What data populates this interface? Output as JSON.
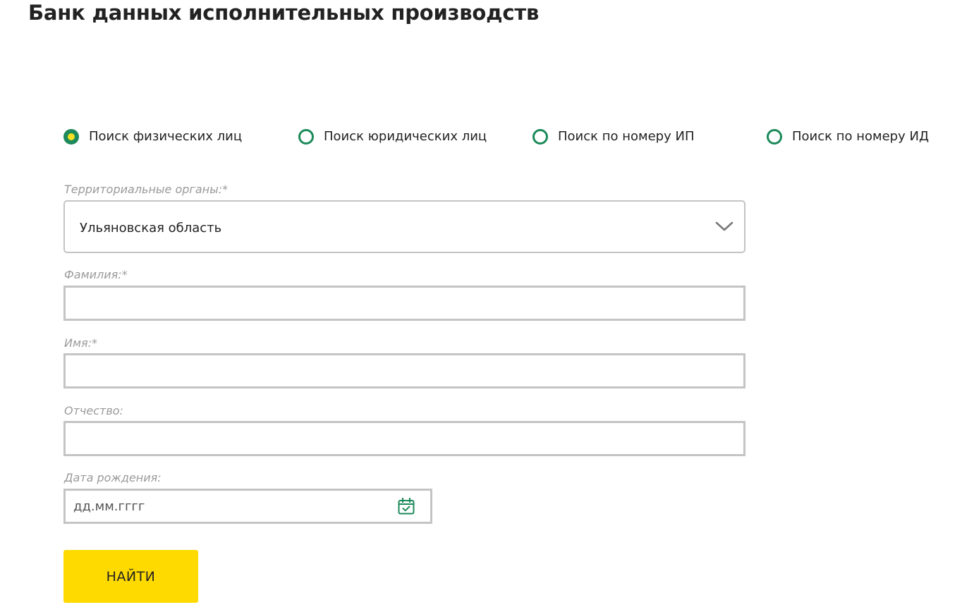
{
  "page": {
    "title": "Банк данных исполнительных производств"
  },
  "search_type": {
    "options": [
      {
        "label": "Поиск физических лиц",
        "checked": true
      },
      {
        "label": "Поиск юридических лиц",
        "checked": false
      },
      {
        "label": "Поиск по номеру ИП",
        "checked": false
      },
      {
        "label": "Поиск по номеру ИД",
        "checked": false
      }
    ]
  },
  "form": {
    "territorial_label": "Территориальные органы:*",
    "territorial_value": "Ульяновская область",
    "lastname_label": "Фамилия:*",
    "lastname_value": "",
    "firstname_label": "Имя:*",
    "firstname_value": "",
    "patronymic_label": "Отчество:",
    "patronymic_value": "",
    "birthdate_label": "Дата рождения:",
    "birthdate_placeholder": "дд.мм.гггг",
    "submit_label": "НАЙТИ"
  },
  "colors": {
    "accent_green": "#1c8a5a",
    "radio_dot_yellow": "#f5e021",
    "button_yellow": "#ffda00",
    "border_gray": "#c4c4c4",
    "label_gray": "#9a9a9a"
  }
}
